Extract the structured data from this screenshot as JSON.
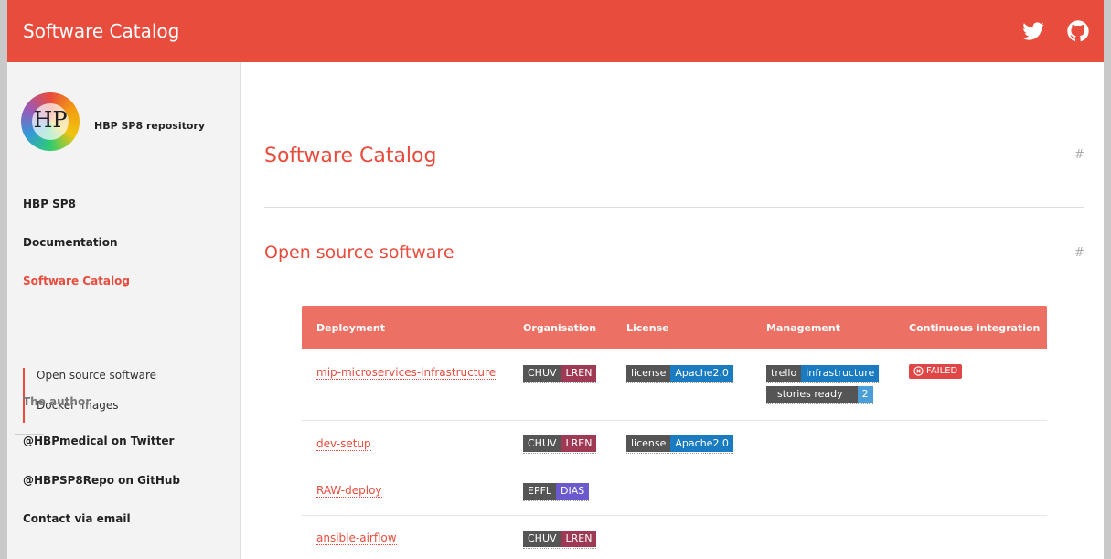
{
  "header": {
    "title": "Software Catalog",
    "twitter_icon": "twitter-icon",
    "github_icon": "github-icon"
  },
  "sidebar": {
    "logo_text": "HP",
    "repo_name": "HBP SP8 repository",
    "nav": [
      "HBP SP8",
      "Documentation",
      "Software Catalog"
    ],
    "subnav": [
      "Open source software",
      "Docker images"
    ],
    "author_heading": "The author",
    "links": [
      "@HBPmedical on Twitter",
      "@HBPSP8Repo on GitHub",
      "Contact via email"
    ]
  },
  "main": {
    "title": "Software Catalog",
    "section": "Open source software",
    "hash": "#"
  },
  "table": {
    "headers": [
      "Deployment",
      "Organisation",
      "License",
      "Management",
      "Continuous integration"
    ],
    "rows": [
      {
        "name": "mip-microservices-infrastructure",
        "org": [
          "CHUV",
          "LREN"
        ],
        "license": [
          "license",
          "Apache2.0"
        ],
        "mgmt": [
          "trello",
          "infrastructure"
        ],
        "stories": [
          "stories ready",
          "2"
        ],
        "ci": "FAILED"
      },
      {
        "name": "dev-setup",
        "org": [
          "CHUV",
          "LREN"
        ],
        "license": [
          "license",
          "Apache2.0"
        ]
      },
      {
        "name": "RAW-deploy",
        "org": [
          "EPFL",
          "DIAS"
        ]
      },
      {
        "name": "ansible-airflow",
        "org": [
          "CHUV",
          "LREN"
        ]
      }
    ]
  },
  "colors": {
    "accent": "#e84c3d",
    "table_header": "#ec7063"
  }
}
